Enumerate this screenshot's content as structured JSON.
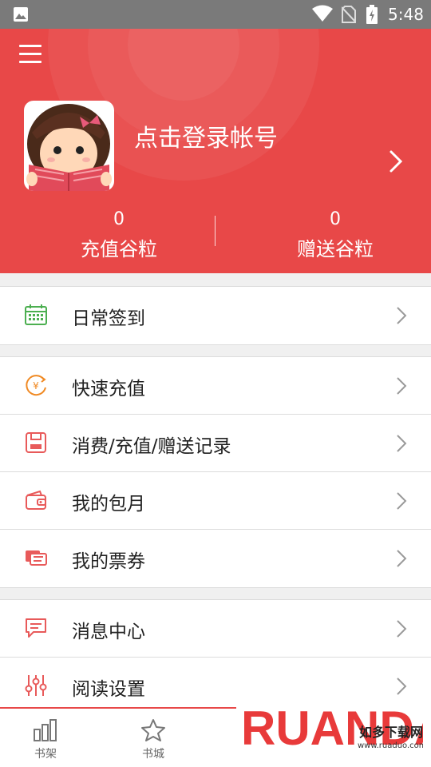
{
  "status_bar": {
    "time": "5:48"
  },
  "header": {
    "login_text": "点击登录帐号",
    "stats": [
      {
        "value": "0",
        "label": "充值谷粒"
      },
      {
        "value": "0",
        "label": "赠送谷粒"
      }
    ]
  },
  "menu": {
    "daily_checkin": "日常签到",
    "quick_recharge": "快速充值",
    "records": "消费/充值/赠送记录",
    "monthly": "我的包月",
    "tickets": "我的票券",
    "messages": "消息中心",
    "reading_settings": "阅读设置"
  },
  "bottom_nav": {
    "bookshelf": "书架",
    "bookstore": "书城"
  },
  "watermark": {
    "logo": "RUANDAO",
    "subtitle": "如多下载网",
    "url": "www.ruaduo.com"
  },
  "colors": {
    "brand_red": "#e84848",
    "checkin_green": "#4caf50",
    "recharge_orange": "#f08a24",
    "icon_red": "#e85a5a"
  }
}
